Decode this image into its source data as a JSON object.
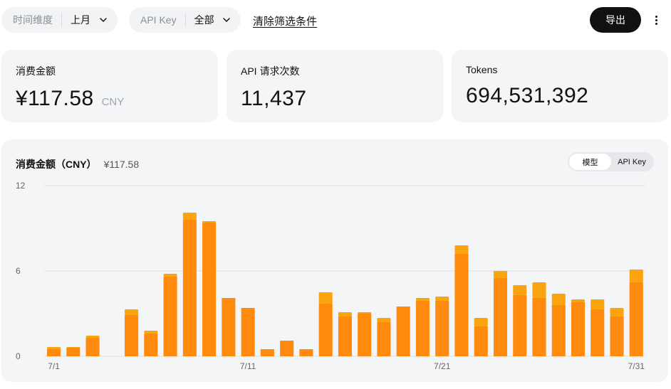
{
  "filters": {
    "time": {
      "label": "时间维度",
      "value": "上月"
    },
    "api_key": {
      "label": "API Key",
      "value": "全部"
    },
    "clear_label": "清除筛选条件"
  },
  "toolbar": {
    "export_label": "导出",
    "more_icon": "more-vertical-icon"
  },
  "stats": {
    "cost": {
      "title": "消费金额",
      "value": "¥117.58",
      "unit": "CNY"
    },
    "requests": {
      "title": "API 请求次数",
      "value": "11,437"
    },
    "tokens": {
      "title": "Tokens",
      "value": "694,531,392"
    }
  },
  "chart": {
    "title": "消费金额（CNY）",
    "total": "¥117.58",
    "toggle": [
      {
        "label": "模型",
        "active": true
      },
      {
        "label": "API Key",
        "active": false
      }
    ]
  },
  "colors": {
    "series_main": "#ff8a0d",
    "series_top": "#fca310",
    "grid": "#dcdee2",
    "axis_text": "#666666"
  },
  "chart_data": {
    "type": "bar",
    "stacked": true,
    "ylim": [
      0,
      12
    ],
    "yticks": [
      "0",
      "6",
      "12"
    ],
    "grid": true,
    "x": [
      "7/1",
      "7/2",
      "7/3",
      "7/4",
      "7/5",
      "7/6",
      "7/7",
      "7/8",
      "7/9",
      "7/10",
      "7/11",
      "7/12",
      "7/13",
      "7/14",
      "7/15",
      "7/16",
      "7/17",
      "7/18",
      "7/19",
      "7/20",
      "7/21",
      "7/22",
      "7/23",
      "7/24",
      "7/25",
      "7/26",
      "7/27",
      "7/28",
      "7/29",
      "7/30",
      "7/31"
    ],
    "x_tick_labels": [
      "7/1",
      "7/11",
      "7/21",
      "7/31"
    ],
    "series": [
      {
        "values": [
          0.5,
          0.6,
          1.3,
          0,
          2.9,
          1.6,
          5.6,
          9.6,
          9.4,
          4.1,
          3.4,
          0.5,
          1.1,
          0.5,
          3.7,
          2.8,
          3.0,
          2.4,
          3.5,
          3.9,
          3.9,
          7.2,
          2.1,
          5.5,
          4.3,
          4.1,
          3.6,
          3.8,
          3.3,
          2.8,
          5.2
        ]
      },
      {
        "values": [
          0.15,
          0.05,
          0.15,
          0,
          0.4,
          0.2,
          0.2,
          0.5,
          0.1,
          0,
          0,
          0,
          0,
          0,
          0.8,
          0.3,
          0.1,
          0.3,
          0,
          0.2,
          0.3,
          0.6,
          0.6,
          0.5,
          0.7,
          1.1,
          0.8,
          0.2,
          0.7,
          0.6,
          0.9
        ]
      }
    ]
  }
}
